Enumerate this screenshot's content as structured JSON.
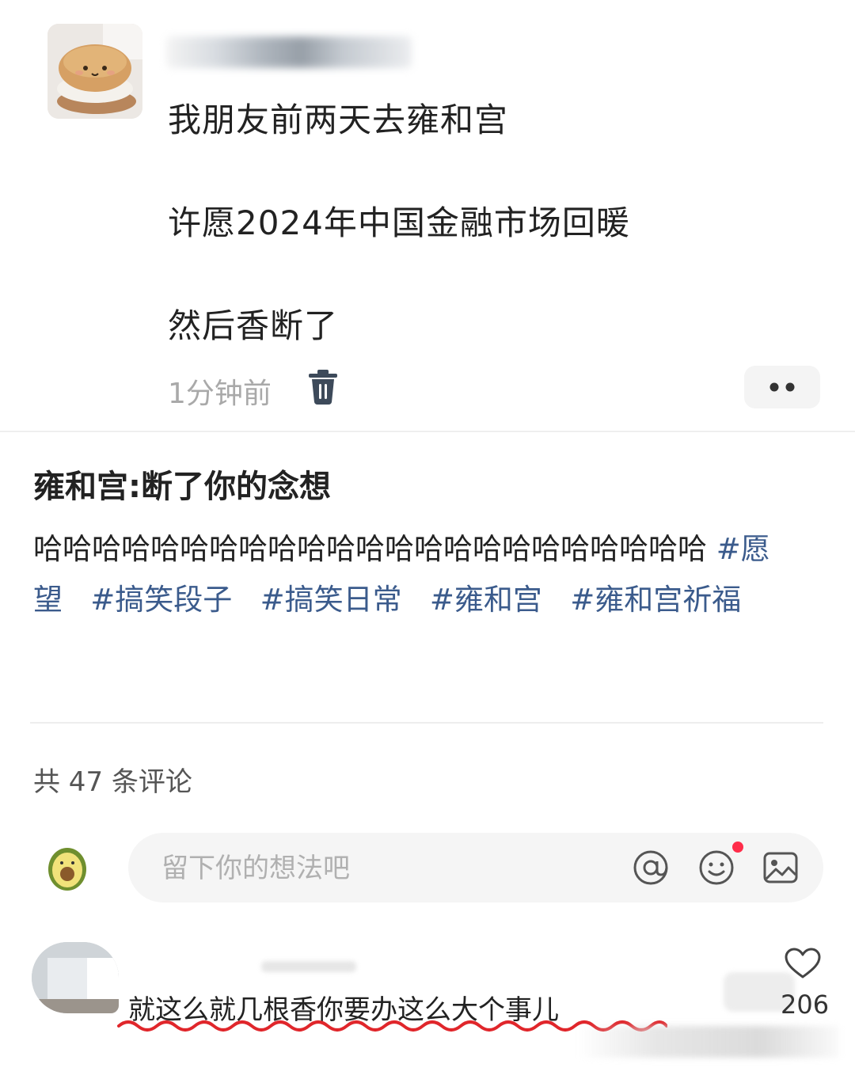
{
  "post": {
    "line1": "我朋友前两天去雍和宫",
    "line2": "许愿2024年中国金融市场回暖",
    "line3": "然后香断了",
    "time": "1分钟前"
  },
  "note": {
    "title": "雍和宫:断了你的念想",
    "body_text": "哈哈哈哈哈哈哈哈哈哈哈哈哈哈哈哈哈哈哈哈哈哈哈 ",
    "hashtags": [
      "#愿望",
      "#搞笑段子",
      "#搞笑日常",
      "#雍和宫",
      "#雍和宫祈福"
    ]
  },
  "comments": {
    "count_label": "共 47 条评论",
    "input_placeholder": "留下你的想法吧",
    "items": [
      {
        "text": "就这么就几根香你要办这么大个事儿",
        "likes": "206"
      }
    ]
  },
  "colors": {
    "hashtag": "#3b5b8c",
    "underline": "#e0262b",
    "notification_dot": "#ff2d4a"
  }
}
